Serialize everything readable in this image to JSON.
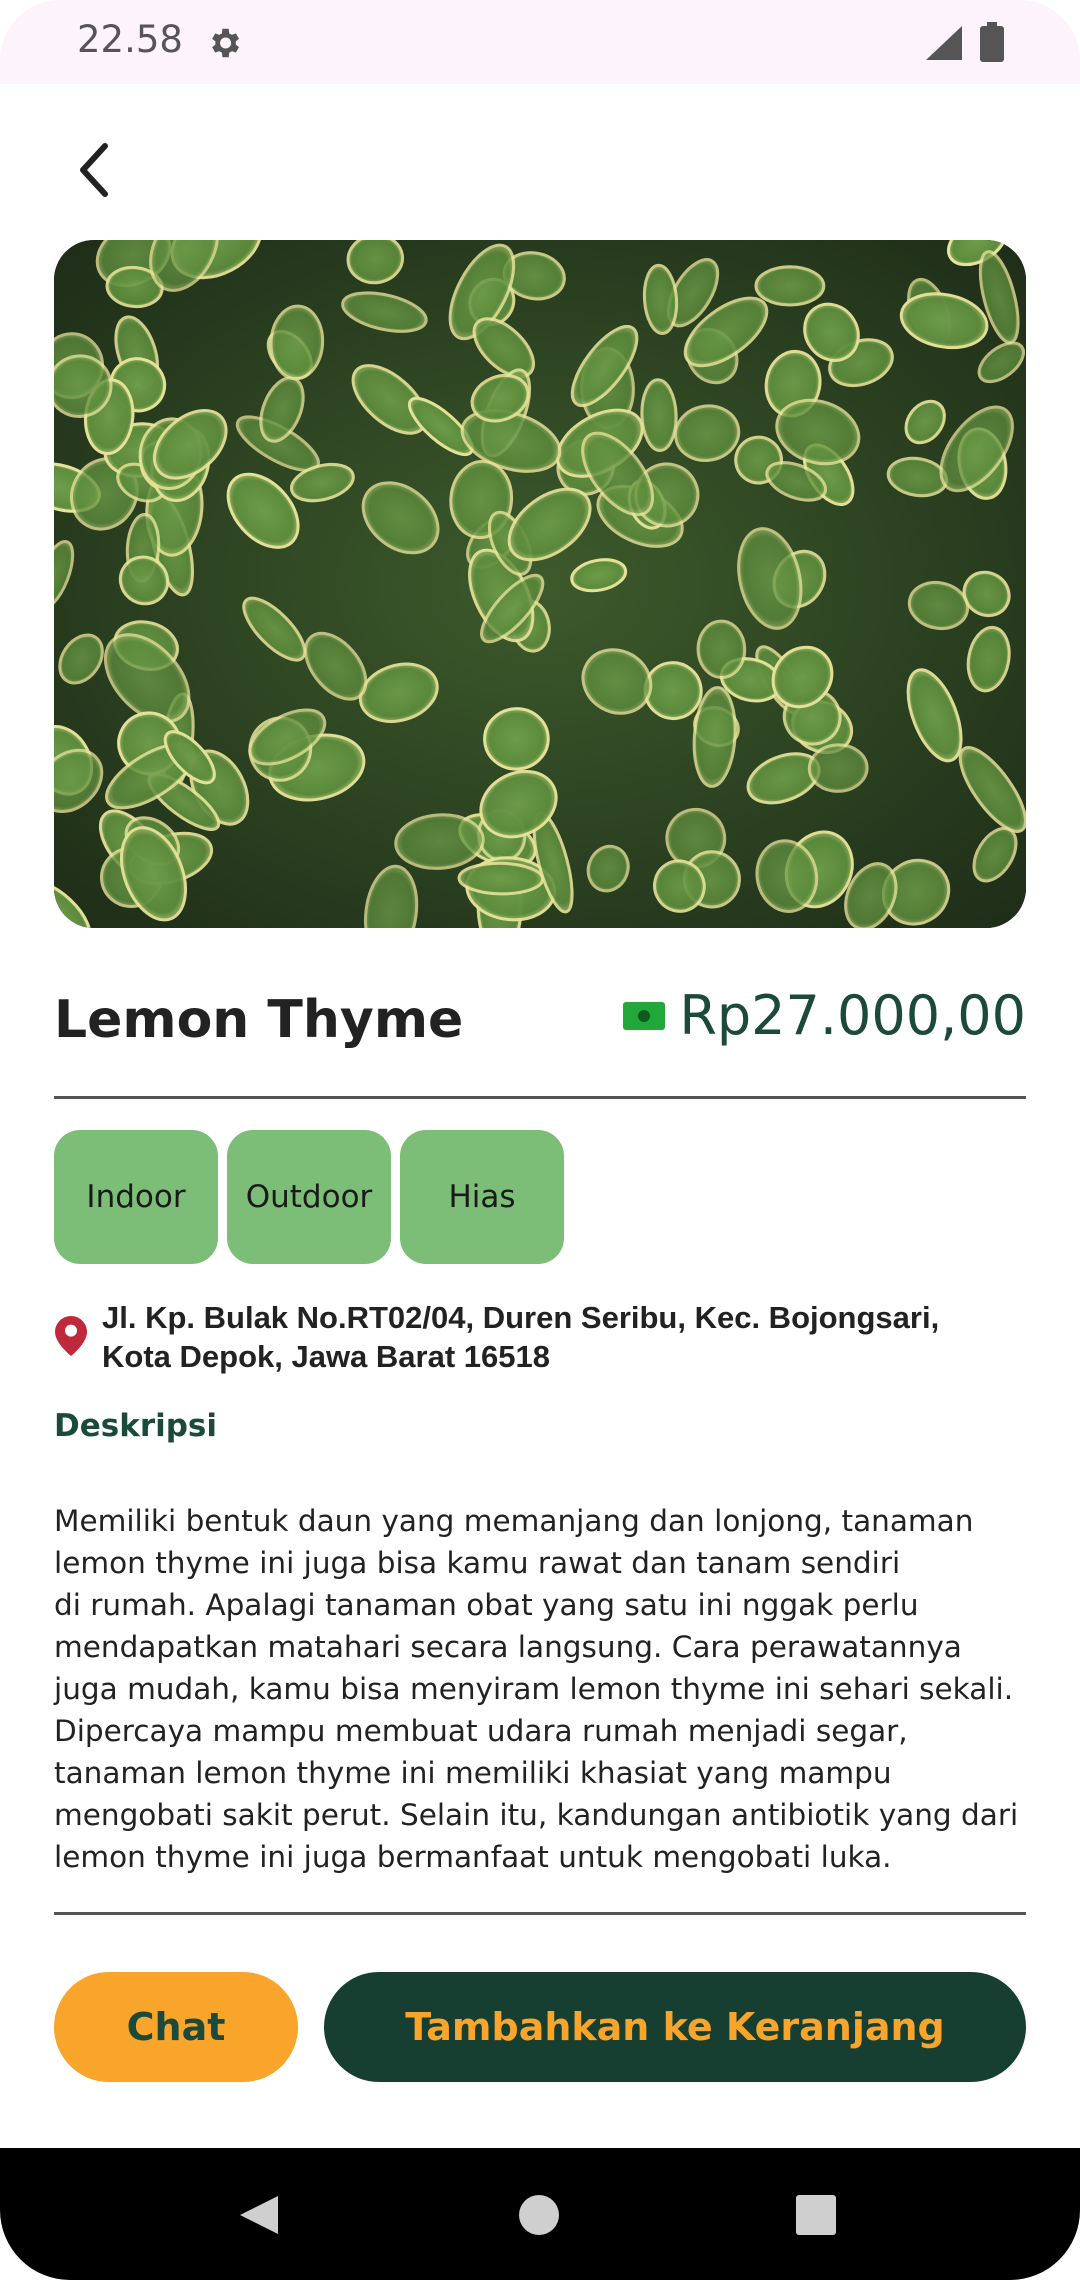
{
  "status_bar": {
    "time": "22.58",
    "icons": [
      "gear-icon",
      "signal-icon",
      "battery-icon"
    ]
  },
  "header": {
    "back_icon": "chevron-left-icon"
  },
  "product": {
    "name": "Lemon Thyme",
    "price": "Rp27.000,00",
    "price_icon": "money-icon",
    "image_subject": "lemon-thyme-plant-photo",
    "tags": [
      "Indoor",
      "Outdoor",
      "Hias"
    ],
    "address": "Jl. Kp. Bulak No.RT02/04, Duren Seribu, Kec. Bojongsari, Kota Depok, Jawa Barat 16518",
    "description_title": "Deskripsi",
    "description": "Memiliki bentuk daun yang memanjang dan lonjong, tanaman\nlemon thyme ini juga bisa kamu rawat dan tanam sendiri\ndi rumah. Apalagi tanaman obat yang satu ini nggak perlu\nmendapatkan matahari secara langsung. Cara perawatannya\njuga mudah, kamu bisa menyiram lemon thyme ini sehari sekali.\nDipercaya mampu membuat udara rumah menjadi segar,\ntanaman lemon thyme ini memiliki khasiat yang mampu\nmengobati sakit perut. Selain itu, kandungan antibiotik yang dari\nlemon thyme ini juga bermanfaat untuk mengobati luka."
  },
  "actions": {
    "chat_label": "Chat",
    "cart_label": "Tambahkan ke Keranjang"
  },
  "nav_bar": {
    "icons": [
      "back-triangle-icon",
      "home-circle-icon",
      "recents-square-icon"
    ]
  },
  "colors": {
    "primary_dark": "#163f32",
    "accent_orange": "#f9a42a",
    "tag_green": "#7cbd77",
    "pin_red": "#c0283c"
  }
}
